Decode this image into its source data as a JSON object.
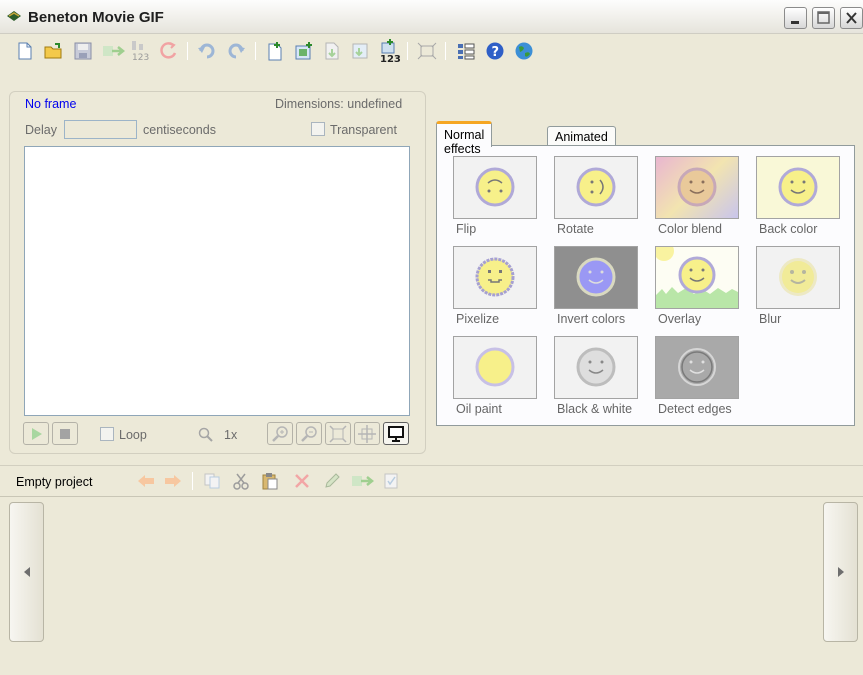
{
  "window": {
    "title": "Beneton Movie GIF"
  },
  "toolbar": {
    "tools": [
      {
        "name": "new-icon"
      },
      {
        "name": "open-icon"
      },
      {
        "name": "save-icon"
      },
      {
        "name": "export-icon"
      },
      {
        "name": "renumber-icon",
        "label": "123"
      },
      {
        "name": "convert-icon"
      },
      {
        "name": "undo-icon"
      },
      {
        "name": "redo-icon"
      },
      {
        "name": "add-frame-icon"
      },
      {
        "name": "insert-frame-icon"
      },
      {
        "name": "import-frames-icon"
      },
      {
        "name": "extract-frames-icon"
      },
      {
        "name": "number-frames-icon",
        "label": "123"
      },
      {
        "name": "resize-icon"
      },
      {
        "name": "properties-icon"
      },
      {
        "name": "help-icon"
      },
      {
        "name": "web-icon"
      }
    ]
  },
  "frame": {
    "status": "No frame",
    "dimensions": "Dimensions: undefined",
    "delay_label": "Delay",
    "delay_value": "",
    "delay_unit": "centiseconds",
    "transparent_label": "Transparent",
    "loop_label": "Loop",
    "zoom_level": "1x"
  },
  "effects": {
    "tabs": [
      "Normal effects",
      "Animated effects"
    ],
    "active_tab": "Normal effects",
    "items": [
      {
        "label": "Flip"
      },
      {
        "label": "Rotate"
      },
      {
        "label": "Color blend"
      },
      {
        "label": "Back color"
      },
      {
        "label": "Pixelize"
      },
      {
        "label": "Invert colors"
      },
      {
        "label": "Overlay"
      },
      {
        "label": "Blur"
      },
      {
        "label": "Oil paint"
      },
      {
        "label": "Black & white"
      },
      {
        "label": "Detect edges"
      }
    ]
  },
  "project": {
    "label": "Empty project"
  },
  "colors": {
    "background": "#ece9d8",
    "link_blue": "#0000ee",
    "active_tab_accent": "#f5a623",
    "smiley_yellow": "#f7f08a"
  }
}
